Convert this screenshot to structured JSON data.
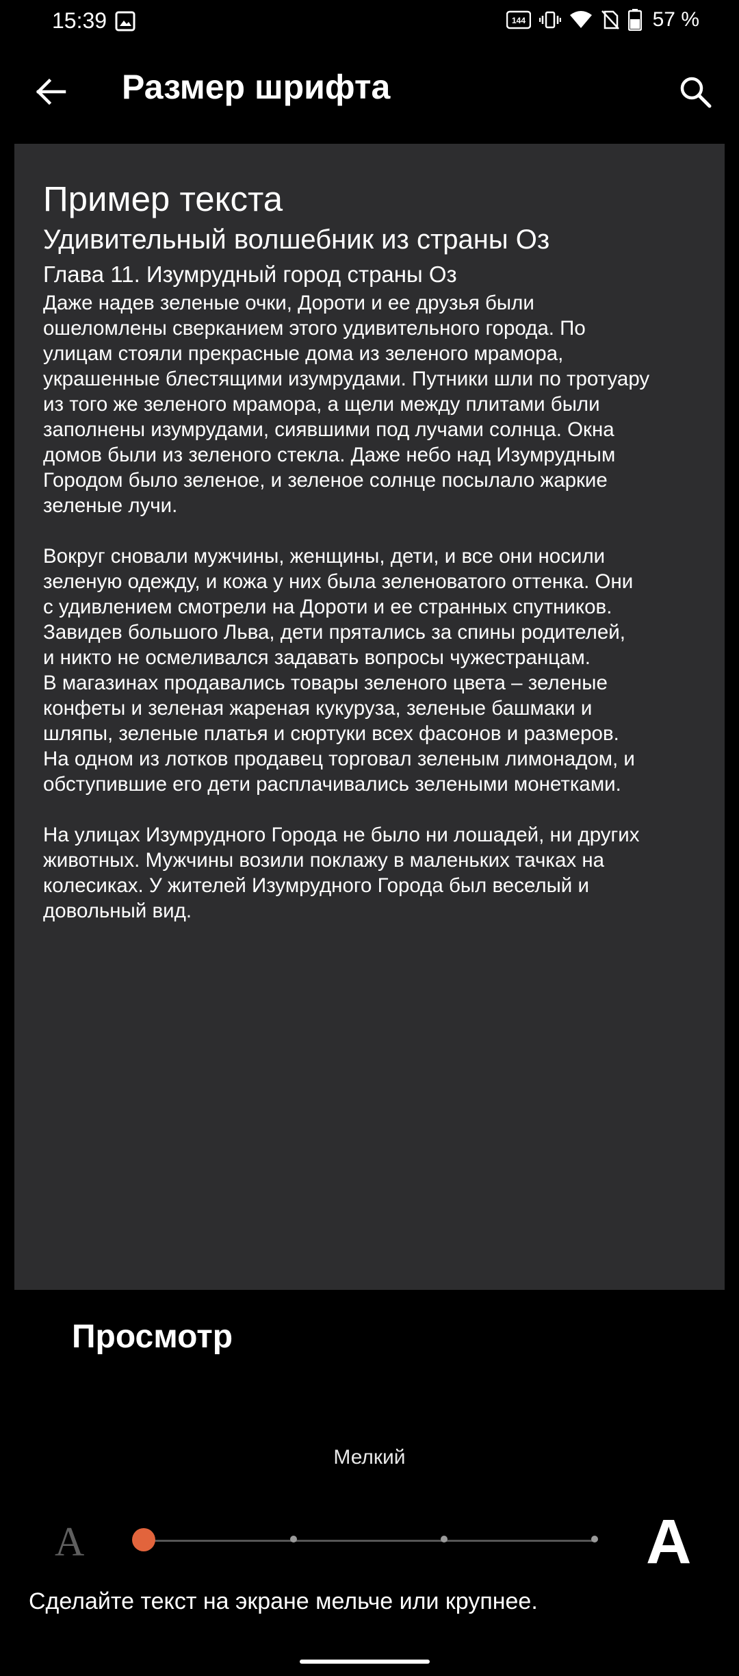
{
  "status": {
    "time": "15:39",
    "battery": "57 %"
  },
  "appbar": {
    "title": "Размер шрифта"
  },
  "preview": {
    "heading": "Пример текста",
    "book_title": "Удивительный волшебник из страны Оз",
    "chapter": "Глава 11. Изумрудный город страны Оз",
    "paragraphs": [
      "Даже надев зеленые очки, Дороти и ее друзья были\nошеломлены сверканием этого удивительного города. По\nулицам стояли прекрасные дома из зеленого мрамора,\nукрашенные блестящими изумрудами. Путники шли по тротуару\nиз того же зеленого мрамора, а щели между плитами были\nзаполнены изумрудами, сиявшими под лучами солнца. Окна\nдомов были из зеленого стекла. Даже небо над Изумрудным\nГородом было зеленое, и зеленое солнце посылало жаркие\nзеленые лучи.",
      "Вокруг сновали мужчины, женщины, дети, и все они носили\nзеленую одежду, и кожа у них была зеленоватого оттенка. Они\nс удивлением смотрели на Дороти и ее странных спутников.\nЗавидев большого Льва, дети прятались за спины родителей,\nи никто не осмеливался задавать вопросы чужестранцам.\nВ магазинах продавались товары зеленого цвета – зеленые\nконфеты и зеленая жареная кукуруза, зеленые башмаки и\nшляпы, зеленые платья и сюртуки всех фасонов и размеров.\nНа одном из лотков продавец торговал зеленым лимонадом, и\nобступившие его дети расплачивались зелеными монетками.",
      "На улицах Изумрудного Города не было ни лошадей, ни других\nживотных. Мужчины возили поклажу в маленьких тачках на\nколесиках. У жителей Изумрудного Города был веселый и\nдовольный вид."
    ]
  },
  "section": {
    "title": "Просмотр"
  },
  "slider": {
    "current_label": "Мелкий",
    "small_glyph": "A",
    "large_glyph": "A",
    "steps": 4,
    "selected_index": 0
  },
  "hint": "Сделайте текст на экране мельче или крупнее.",
  "colors": {
    "accent": "#e2643c",
    "card_bg": "#2d2d2f",
    "background": "#000000"
  }
}
